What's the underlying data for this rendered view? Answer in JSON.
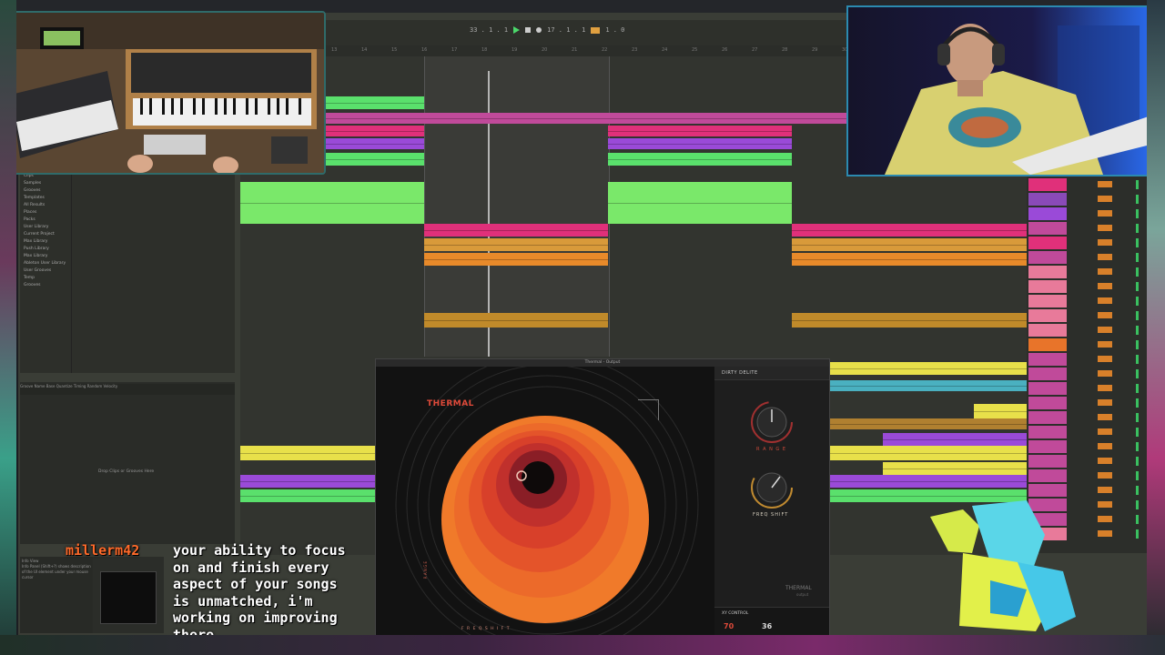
{
  "transport": {
    "bar_position": "33 . 1 . 1",
    "loop_length": "17 . 1 . 1",
    "tempo": "1 . 0"
  },
  "ruler": {
    "bar_numbers": [
      "13",
      "14",
      "15",
      "16",
      "17",
      "18",
      "19",
      "20",
      "21",
      "22",
      "23",
      "24",
      "25",
      "26",
      "27",
      "28",
      "29",
      "30",
      "31",
      "32",
      "33",
      "34",
      "35",
      "36"
    ]
  },
  "browser": {
    "items": [
      "Clips",
      "Samples",
      "Grooves",
      "Templates",
      "All Results",
      "Places",
      "Packs",
      "User Library",
      "Current Project",
      "Max Library",
      "Push Library",
      "Max Library",
      "Ableton User Library",
      "User Grooves",
      "Temp",
      "Grooves"
    ]
  },
  "groove_pool": {
    "header": "Groove Name  Base  Quantize  Timing  Random  Velocity",
    "drop_text": "Drop Clips or Grooves Here"
  },
  "info_panel": {
    "title": "Info View",
    "text": "Info Panel (Shift+?) shows description of the UI element under your mouse cursor"
  },
  "plugin": {
    "window_title": "Thermal - Output",
    "brand": "THERMAL",
    "preset": "DIRTY DELITE",
    "knob1_label": "R A N G E",
    "knob2_label": "FREQ SHIFT",
    "xy_label": "XY CONTROL",
    "xy_value_1": "70",
    "xy_value_2": "36",
    "footer_brand": "THERMAL",
    "footer_sub": "output",
    "freq_shift_axis": "F R E Q   S H I F T",
    "range_axis": "R A N G E"
  },
  "chat": {
    "username": "millerm42",
    "message": "your ability to focus\non and finish every\naspect of your songs\nis unmatched, i'm\nworking on improving\nthere"
  },
  "colors": {
    "green_clip": "#5ae06c",
    "pink_clip": "#e0307a",
    "purple_clip": "#9a4ad8",
    "orange_clip": "#e8a23a",
    "yellow_clip": "#e8e04a",
    "thermal_red": "#e04a3a"
  }
}
